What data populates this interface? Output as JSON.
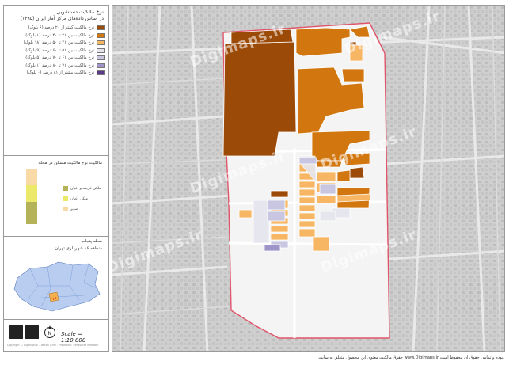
{
  "map_title": "نرخ مالکیت دستشویی",
  "map_subtitle": "در اساس داده‌های مرکز آمار ایران (۱۳۹۵)",
  "legend": [
    {
      "label": "نرخ مالکیت کمتر از ۲۰ درصد (۶ بلوک)",
      "color": "#9c4a08"
    },
    {
      "label": "نرخ مالکیت بین ۲۱ تا ۴۰ درصد (۱ بلوک)",
      "color": "#d2770f"
    },
    {
      "label": "نرخ مالکیت بین ۴۱ تا ۵۰ درصد (۱۸ بلوک)",
      "color": "#f6b663"
    },
    {
      "label": "نرخ مالکیت بین ۵۱ تا ۶۰ درصد (۹ بلوک)",
      "color": "#e6e6ee"
    },
    {
      "label": "نرخ مالکیت بین ۶۱ تا ۷۰ درصد (۵ بلوک)",
      "color": "#c8c6e0"
    },
    {
      "label": "نرخ مالکیت بین ۷۱ تا ۸۰ درصد (۱ بلوک)",
      "color": "#9e94c8"
    },
    {
      "label": "نرخ مالکیت بیشتر از ۸۱ درصد (۰ بلوک)",
      "color": "#5b3a8a"
    }
  ],
  "chart_title": "مالکیت نوع مالکیت مسکن در محله",
  "chart_legend": [
    {
      "label": "ملکی عرصه و اعیان",
      "color": "#b5b35a"
    },
    {
      "label": "ملکی اعیان",
      "color": "#ece86a"
    },
    {
      "label": "سایر",
      "color": "#f9d9a6"
    }
  ],
  "chart_segments": [
    {
      "value": 40,
      "color": "#b5b35a"
    },
    {
      "value": 30,
      "color": "#ece86a"
    },
    {
      "value": 30,
      "color": "#f9d9a6"
    }
  ],
  "inset_title_1": "محله پنجاب",
  "inset_title_2": "منطقه ۱۶ شهرداری تهران",
  "inset_marker": "۱۶",
  "scale_text": "Scale = 1:10,000",
  "north_label": "N",
  "small_note": "Copyright © Digimaps.ir - Tehran 1395 - Projection: Transverse Mercator",
  "watermark": "Digimaps.ir",
  "footer": "حقوق مالکیت معنوی این محصول متعلق به سایت www.Digimaps.ir بوده و تمامی حقوق آن محفوظ است.",
  "colors": {
    "boundary": "#e0556a",
    "map_bg": "#cfcfcf",
    "inside_bg": "#f4f4f4"
  }
}
